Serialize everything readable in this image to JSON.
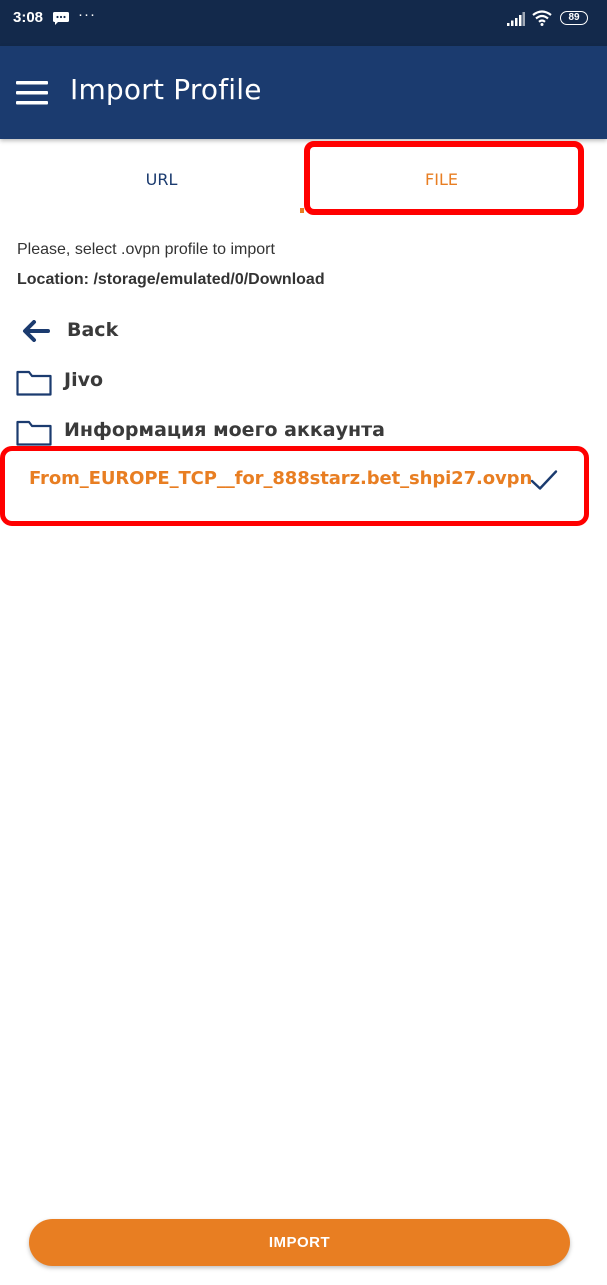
{
  "status_bar": {
    "time": "3:08",
    "notification_dots": "···",
    "battery": "89",
    "icons": [
      "message-icon",
      "signal-icon",
      "wifi-icon",
      "battery-icon"
    ]
  },
  "app_bar": {
    "title": "Import Profile",
    "menu_icon": "hamburger-menu-icon",
    "background_color": "#1b3b6f"
  },
  "tabs": [
    {
      "label": "URL",
      "selected": false
    },
    {
      "label": "FILE",
      "selected": true
    }
  ],
  "content": {
    "instruction": "Please, select .ovpn profile to import",
    "location": "Location: /storage/emulated/0/Download"
  },
  "file_list": {
    "back_label": "Back",
    "items": [
      {
        "label": "Jivo",
        "type": "folder",
        "icon": "folder-icon"
      },
      {
        "label": "Информация моего аккаунта",
        "type": "folder",
        "icon": "folder-icon"
      },
      {
        "label": "From_EUROPE_TCP__for_888starz.bet_shpi27.ovpn",
        "type": "file",
        "selected": true,
        "icon": "check-icon"
      }
    ]
  },
  "import_button": {
    "label": "IMPORT"
  },
  "colors": {
    "accent": "#e87e22",
    "primary": "#1b3b6f",
    "status_bar": "#13294b",
    "annotation": "#ff0000"
  }
}
